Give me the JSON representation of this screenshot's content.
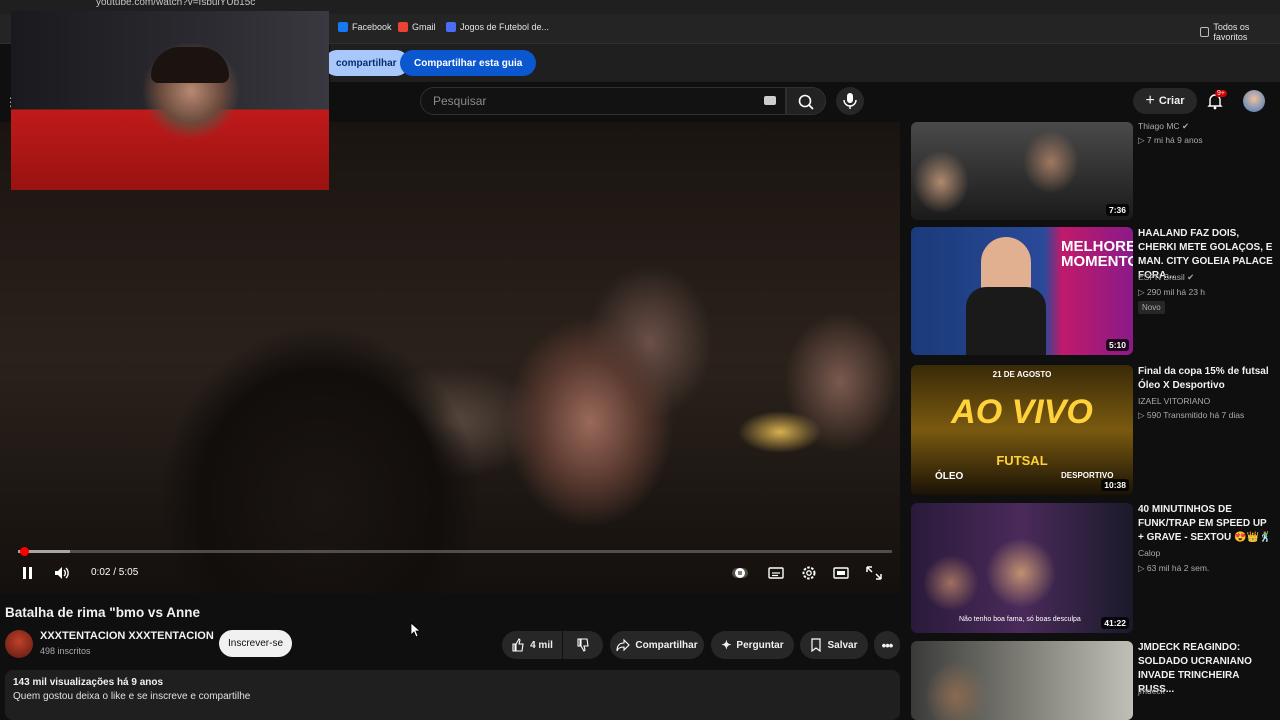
{
  "browser": {
    "url": "youtube.com/watch?v=fsbulYUb15c",
    "bookmarks": [
      {
        "label": "Facebook",
        "icon": "facebook-icon",
        "color": "#1877f2"
      },
      {
        "label": "Gmail",
        "icon": "gmail-icon",
        "color": "#ea4335"
      },
      {
        "label": "Jogos de Futebol de...",
        "icon": "bookmark-site-icon",
        "color": "#4a6cf7"
      }
    ],
    "all_favorites": "Todos os favoritos"
  },
  "sharebar": {
    "share_left": "compartilhar",
    "share_tab": "Compartilhar esta guia"
  },
  "header": {
    "search_placeholder": "Pesquisar",
    "create_label": "Criar",
    "notif_count": "9+"
  },
  "player": {
    "time": "0:02 / 5:05",
    "progress_fraction": 0.007,
    "buffered_fraction": 0.06
  },
  "video": {
    "title": "Batalha de rima \"bmo vs Anne",
    "channel": "XXXTENTACION XXXTENTACION",
    "subscribers": "498 inscritos",
    "subscribe_label": "Inscrever-se",
    "likes": "4 mil",
    "share_label": "Compartilhar",
    "ask_label": "Perguntar",
    "save_label": "Salvar",
    "views_line": "143 mil visualizações  há 9 anos",
    "description": "Quem gostou deixa o like e  se inscreve e compartilhe"
  },
  "sidebar": {
    "items": [
      {
        "title": "",
        "channel": "Thiago MC",
        "meta": "▷ 7 mi  há 9 anos",
        "duration": "7:36",
        "badge": ""
      },
      {
        "title": "HAALAND FAZ DOIS, CHERKI METE GOLAÇOS, E MAN. CITY GOLEIA PALACE FORA...",
        "channel": "ESPN Brasil",
        "meta": "▷ 290 mil  há 23 h",
        "duration": "5:10",
        "badge": "Novo"
      },
      {
        "title": "Final da copa 15% de futsal Óleo X Desportivo",
        "channel": "IZAEL VITORIANO",
        "meta": "▷ 590  Transmitido há 7 dias",
        "duration": "10:38",
        "badge": ""
      },
      {
        "title": "40 MINUTINHOS DE FUNK/TRAP EM SPEED UP + GRAVE - SEXTOU 😍👑🕺",
        "channel": "Calop",
        "meta": "▷ 63 mil  há 2 sem.",
        "duration": "41:22",
        "badge": ""
      },
      {
        "title": "JMDECK REAGINDO: SOLDADO UCRANIANO INVADE TRINCHEIRA RUSS...",
        "channel": "jmdeck",
        "meta": "",
        "duration": "",
        "badge": ""
      }
    ],
    "thumb_texts": {
      "espn_overlay": "MELHORES MOMENTOS",
      "live_text": "AO VIVO",
      "live_date": "21 DE AGOSTO",
      "futsal": "FUTSAL",
      "team_a": "ÓLEO",
      "team_b": "DESPORTIVO",
      "calop_caption": "Não tenho boa fama, só boas desculpa"
    }
  }
}
